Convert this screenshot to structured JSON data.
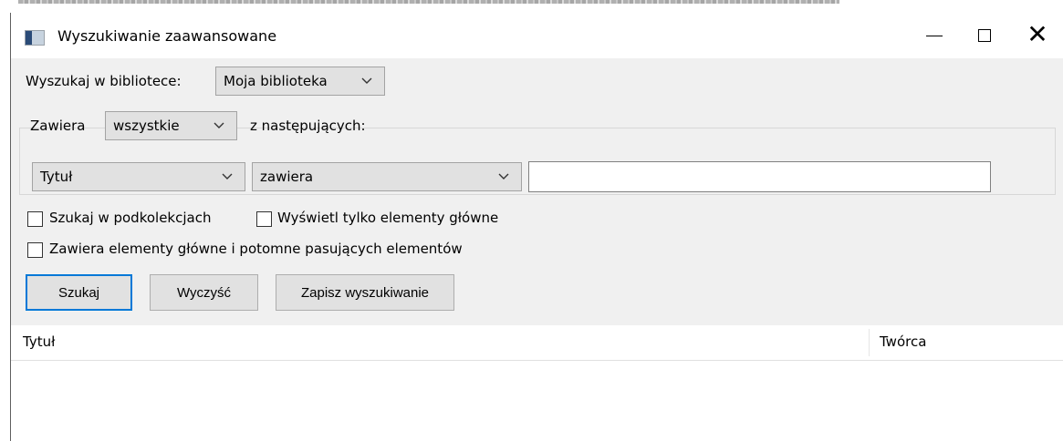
{
  "window": {
    "title": "Wyszukiwanie zaawansowane",
    "minimize_label": "—",
    "maximize_label": "",
    "close_label": "✕"
  },
  "library": {
    "label": "Wyszukaj w bibliotece:",
    "selected": "Moja biblioteka"
  },
  "condition_group": {
    "contains_label": "Zawiera",
    "match_selected": "wszystkie",
    "following_label": "z następujących:",
    "field_selected": "Tytuł",
    "operator_selected": "zawiera",
    "value": ""
  },
  "options": {
    "search_subcollections": {
      "label": "Szukaj w podkolekcjach",
      "checked": false
    },
    "show_only_top_level": {
      "label": "Wyświetl tylko elementy główne",
      "checked": false
    },
    "include_parent_child": {
      "label": "Zawiera elementy główne i potomne pasujących elementów",
      "checked": false
    }
  },
  "buttons": {
    "search": "Szukaj",
    "clear": "Wyczyść",
    "save_search": "Zapisz wyszukiwanie"
  },
  "results": {
    "columns": [
      "Tytuł",
      "Twórca"
    ]
  },
  "icons": {
    "app": "library-app-icon",
    "dropdown": "chevron-down-icon"
  }
}
